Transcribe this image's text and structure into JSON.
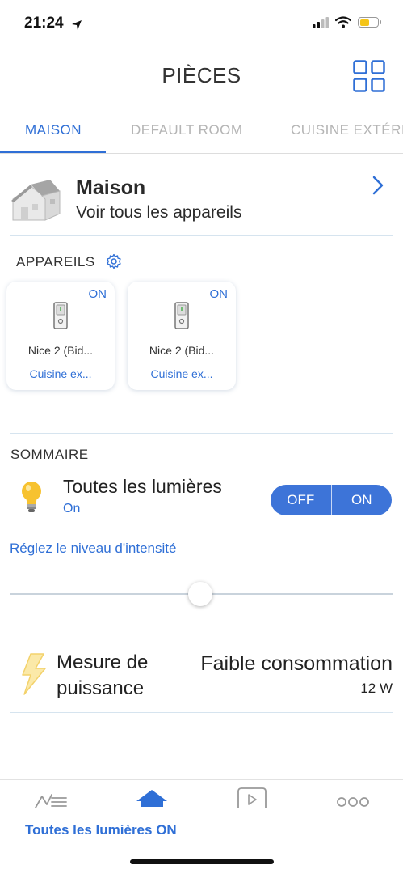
{
  "status_bar": {
    "time": "21:24"
  },
  "header": {
    "title": "PIÈCES"
  },
  "tabs": [
    {
      "label": "MAISON"
    },
    {
      "label": "DEFAULT ROOM"
    },
    {
      "label": "CUISINE EXTÉRIEURE"
    }
  ],
  "house": {
    "title": "Maison",
    "subtitle": "Voir tous les appareils"
  },
  "devices": {
    "section_label": "APPAREILS",
    "items": [
      {
        "status": "ON",
        "name": "Nice 2 (Bid...",
        "room": "Cuisine ex..."
      },
      {
        "status": "ON",
        "name": "Nice 2 (Bid...",
        "room": "Cuisine ex..."
      }
    ]
  },
  "summary": {
    "section_label": "SOMMAIRE",
    "lights": {
      "title": "Toutes les lumières",
      "state": "On",
      "off_label": "OFF",
      "on_label": "ON"
    },
    "intensity": {
      "label": "Réglez le niveau d'intensité",
      "level": 0.5
    }
  },
  "power": {
    "label_line1": "Mesure de",
    "label_line2": "puissance",
    "value": "Faible consommation",
    "watts": "12 W"
  },
  "tabbar": {
    "status_text": "Toutes les lumières ON"
  },
  "colors": {
    "accent": "#2f6fd6",
    "toggle": "#3d74d8"
  }
}
